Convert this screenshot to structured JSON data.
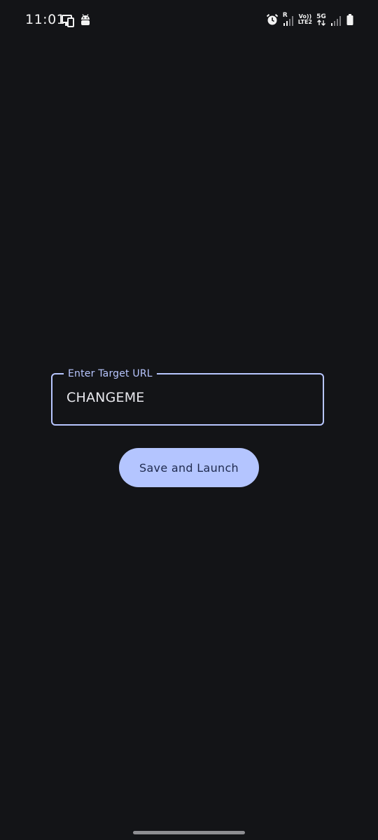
{
  "status_bar": {
    "time": "11:01",
    "left_icons": [
      "screen-mirror-icon",
      "android-icon"
    ],
    "right_icons": [
      "alarm-icon",
      "roaming-signal-icon",
      "volte-icon",
      "5g-icon",
      "cell-signal-icon",
      "battery-icon"
    ],
    "roaming_label": "R",
    "volte_label_top": "Vo))",
    "volte_label_bottom": "LTE2",
    "network_label": "5G"
  },
  "form": {
    "url_field": {
      "label": "Enter Target URL",
      "value": "CHANGEME"
    },
    "save_button_label": "Save and Launch"
  },
  "colors": {
    "background": "#131417",
    "accent": "#b8c6ff",
    "button_bg": "#b4c5ff",
    "button_text": "#1f2a4e"
  }
}
